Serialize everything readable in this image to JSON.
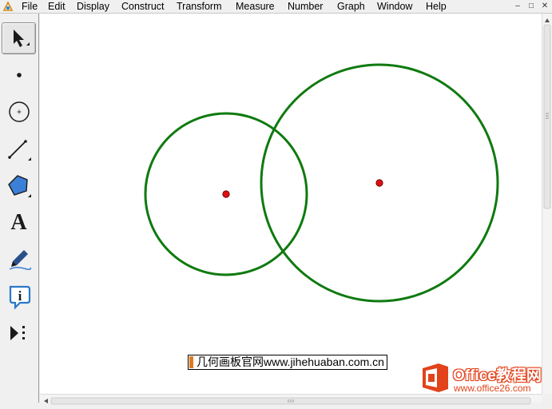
{
  "menu": [
    "File",
    "Edit",
    "Display",
    "Construct",
    "Transform",
    "Measure",
    "Number",
    "Graph",
    "Window",
    "Help"
  ],
  "window_controls": [
    "–",
    "□",
    "✕"
  ],
  "tools": [
    {
      "name": "arrow-tool",
      "icon": "select-arrow-icon"
    },
    {
      "name": "point-tool",
      "icon": "point-icon"
    },
    {
      "name": "compass-tool",
      "icon": "compass-circle-icon"
    },
    {
      "name": "straightedge-tool",
      "icon": "straightedge-icon"
    },
    {
      "name": "polygon-tool",
      "icon": "polygon-icon"
    },
    {
      "name": "text-tool",
      "icon": "text-tool-icon",
      "label": "A"
    },
    {
      "name": "marker-tool",
      "icon": "marker-pen-icon"
    },
    {
      "name": "information-tool",
      "icon": "info-icon",
      "label": "i"
    },
    {
      "name": "custom-tool",
      "icon": "custom-tool-icon"
    }
  ],
  "colors": {
    "circle_stroke": "#0f7a0f",
    "center_point": "#e01010",
    "polygon_fill": "#3b7fd6",
    "watermark_orange": "#e2431a"
  },
  "caption": "几何画板官网www.jihehuaban.com.cn",
  "watermark": {
    "title": "Office教程网",
    "url": "www.office26.com"
  }
}
